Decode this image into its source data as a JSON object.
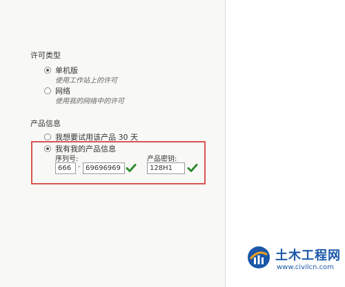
{
  "license": {
    "title": "许可类型",
    "options": [
      {
        "label": "单机版",
        "desc": "使用工作站上的许可",
        "selected": true
      },
      {
        "label": "网络",
        "desc": "使用我的网络中的许可",
        "selected": false
      }
    ]
  },
  "product": {
    "title": "产品信息",
    "options": [
      {
        "label": "我想要试用该产品 30 天",
        "selected": false
      },
      {
        "label": "我有我的产品信息",
        "selected": true
      }
    ],
    "serial_label": "序列号:",
    "serial_part1": "666",
    "serial_sep": "-",
    "serial_part2": "69696969",
    "key_label": "产品密钥:",
    "key_value": "128H1"
  },
  "colors": {
    "highlight": "#d9534f",
    "check": "#2e8b2e",
    "watermark": "#1a57a8"
  },
  "icons": [
    "check-icon",
    "watermark-logo-icon"
  ],
  "watermark": {
    "title": "土木工程网",
    "url": "www.civilcn.com"
  }
}
